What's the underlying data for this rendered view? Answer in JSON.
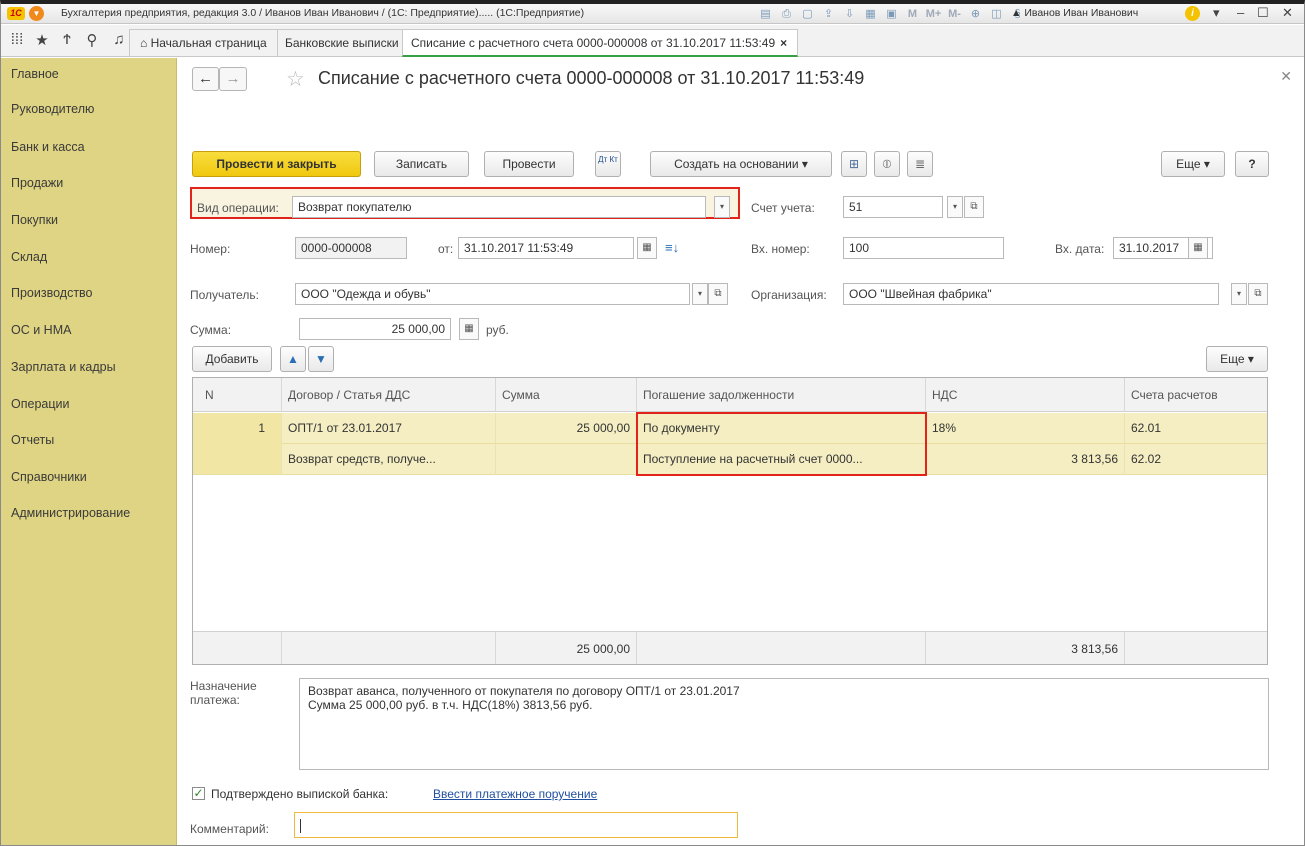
{
  "titlebar": {
    "app_title": "Бухгалтерия предприятия, редакция 3.0 / Иванов Иван Иванович / (1С: Предприятие)..... (1С:Предприятие)",
    "logo_text": "1С",
    "mm_labels": [
      "M",
      "M+",
      "M-"
    ],
    "user": "Иванов Иван Иванович"
  },
  "tabs": [
    {
      "label": "Начальная страница"
    },
    {
      "label": "Банковские выписки",
      "close": "×"
    },
    {
      "label": "Списание с расчетного счета 0000-000008 от 31.10.2017 11:53:49",
      "close": "×"
    }
  ],
  "sidebar": {
    "items": [
      "Главное",
      "Руководителю",
      "Банк и касса",
      "Продажи",
      "Покупки",
      "Склад",
      "Производство",
      "ОС и НМА",
      "Зарплата и кадры",
      "Операции",
      "Отчеты",
      "Справочники",
      "Администрирование"
    ]
  },
  "document": {
    "title": "Списание с расчетного счета 0000-000008 от 31.10.2017 11:53:49"
  },
  "toolbar": {
    "post_close": "Провести и закрыть",
    "save": "Записать",
    "post": "Провести",
    "dtkt": "Дт Кт",
    "create_based": "Создать на основании",
    "more": "Еще",
    "help": "?"
  },
  "form": {
    "op_type_label": "Вид операции:",
    "op_type_value": "Возврат покупателю",
    "account_label": "Счет учета:",
    "account_value": "51",
    "number_label": "Номер:",
    "number_value": "0000-000008",
    "from_label": "от:",
    "from_value": "31.10.2017 11:53:49",
    "in_number_label": "Вх. номер:",
    "in_number_value": "100",
    "in_date_label": "Вх. дата:",
    "in_date_value": "31.10.2017",
    "recipient_label": "Получатель:",
    "recipient_value": "ООО \"Одежда и обувь\"",
    "org_label": "Организация:",
    "org_value": "ООО \"Швейная фабрика\"",
    "sum_label": "Сумма:",
    "sum_value": "25 000,00",
    "currency": "руб."
  },
  "table": {
    "add": "Добавить",
    "more": "Еще",
    "columns": [
      "N",
      "Договор / Статья ДДС",
      "Сумма",
      "Погашение задолженности",
      "НДС",
      "Счета расчетов"
    ],
    "rows": [
      {
        "n": "1",
        "contract": "ОПТ/1 от 23.01.2017",
        "sum": "25 000,00",
        "repayment": "По документу",
        "vat": "18%",
        "accounts": "62.01"
      },
      {
        "n": "",
        "contract": "Возврат средств, получе...",
        "sum": "",
        "repayment": "Поступление на расчетный счет 0000...",
        "vat": "3 813,56",
        "accounts": "62.02"
      }
    ],
    "footer": {
      "sum": "25 000,00",
      "vat": "3 813,56"
    }
  },
  "purpose": {
    "label": "Назначение платежа:",
    "line1": "Возврат аванса, полученного от покупателя по договору ОПТ/1 от 23.01.2017",
    "line2": "Сумма 25 000,00 руб. в т.ч. НДС(18%) 3813,56 руб."
  },
  "bank": {
    "checkbox_label": "Подтверждено выпиской банка:",
    "link": "Ввести платежное поручение"
  },
  "comment": {
    "label": "Комментарий:",
    "value": ""
  },
  "colors": {
    "sidebar": "#dfd483",
    "primary_button": "#f0c80f",
    "highlight_box": "#e2231a",
    "row_bg": "#f4eec2"
  }
}
